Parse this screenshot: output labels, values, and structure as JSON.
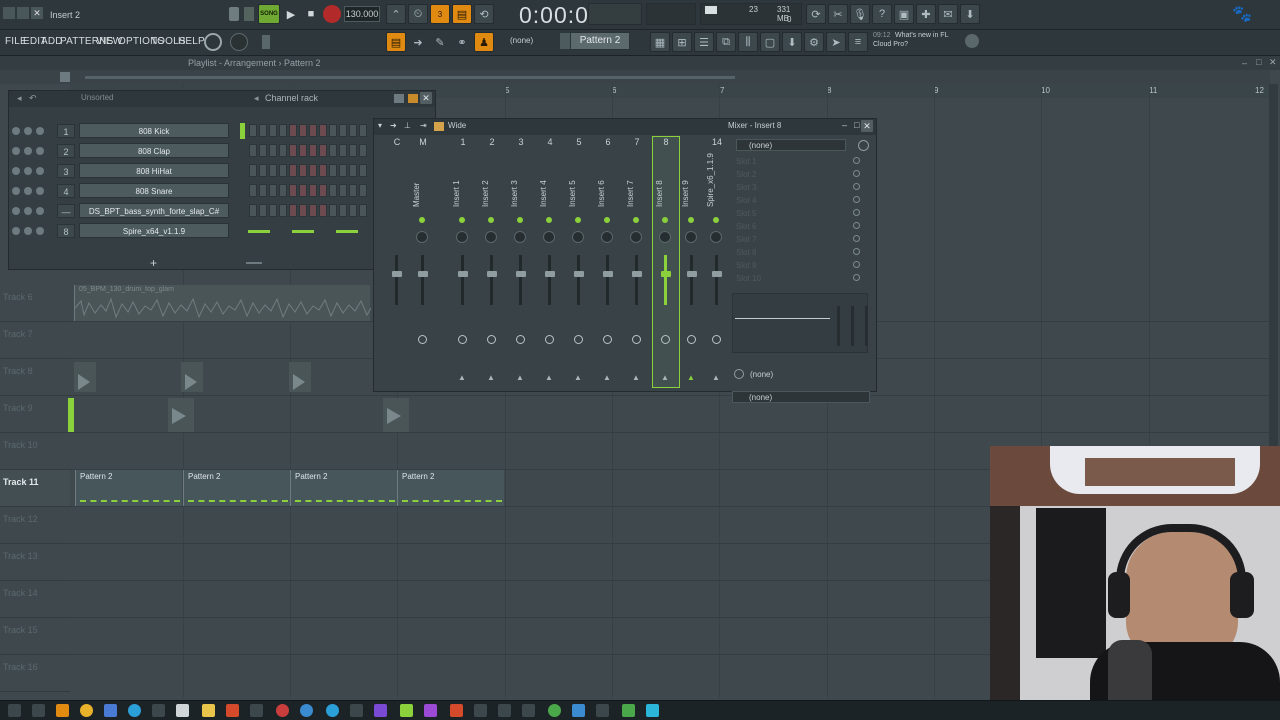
{
  "window": {
    "title": "Insert 2"
  },
  "transport": {
    "song_label": "SONG",
    "tempo": "130.000",
    "time": "0:00:00",
    "cpu": "23",
    "memory": "331 MB",
    "poly": "0",
    "hint_time": "09:12",
    "hint_text_1": "What's new in FL",
    "hint_text_2": "Cloud Pro?"
  },
  "menu": [
    "FILE",
    "EDIT",
    "ADD",
    "PATTERNS",
    "VIEW",
    "OPTIONS",
    "TOOLS",
    "HELP"
  ],
  "toolbar": {
    "snap": "(none)",
    "pattern": "Pattern 2"
  },
  "playlist": {
    "title": "Playlist - Arrangement › Pattern 2",
    "bar_numbers": [
      "5",
      "6",
      "7",
      "8",
      "9",
      "10",
      "11",
      "12"
    ],
    "tracks": [
      "Track 6",
      "Track 7",
      "Track 8",
      "Track 9",
      "Track 10",
      "Track 11",
      "Track 12",
      "Track 13",
      "Track 14",
      "Track 15",
      "Track 16"
    ],
    "active_track": "Track 11",
    "audio_clip_label": "05_BPM_130_drum_top_glam",
    "pattern_clips": [
      "Pattern 2",
      "Pattern 2",
      "Pattern 2",
      "Pattern 2"
    ]
  },
  "browser": {
    "filter": "Unsorted"
  },
  "channel_rack": {
    "title": "Channel rack",
    "channels": [
      {
        "num": "1",
        "name": "808 Kick"
      },
      {
        "num": "2",
        "name": "808 Clap"
      },
      {
        "num": "3",
        "name": "808 HiHat"
      },
      {
        "num": "4",
        "name": "808 Snare"
      },
      {
        "num": "—",
        "name": "DS_BPT_bass_synth_forte_slap_C#"
      },
      {
        "num": "8",
        "name": "Spire_x64_v1.1.9"
      }
    ],
    "add_label": "+"
  },
  "mixer": {
    "preset": "Wide",
    "title": "Mixer - Insert 8",
    "strips": [
      {
        "num": "C",
        "name": ""
      },
      {
        "num": "M",
        "name": "Master"
      },
      {
        "num": "1",
        "name": "Insert 1"
      },
      {
        "num": "2",
        "name": "Insert 2"
      },
      {
        "num": "3",
        "name": "Insert 3"
      },
      {
        "num": "4",
        "name": "Insert 4"
      },
      {
        "num": "5",
        "name": "Insert 5"
      },
      {
        "num": "6",
        "name": "Insert 6"
      },
      {
        "num": "7",
        "name": "Insert 7"
      },
      {
        "num": "8",
        "name": "Insert 8"
      },
      {
        "num": "",
        "name": "Insert 9"
      },
      {
        "num": "14",
        "name": "Spire_x6_1.1.9"
      }
    ],
    "input": "(none)",
    "slots": [
      "Slot 1",
      "Slot 2",
      "Slot 3",
      "Slot 4",
      "Slot 5",
      "Slot 6",
      "Slot 7",
      "Slot 8",
      "Slot 9",
      "Slot 10"
    ],
    "eq_out": "(none)",
    "output": "(none)"
  },
  "colors": {
    "accent_green": "#8bd13c",
    "accent_orange": "#e08a12",
    "background": "#3f494d"
  }
}
